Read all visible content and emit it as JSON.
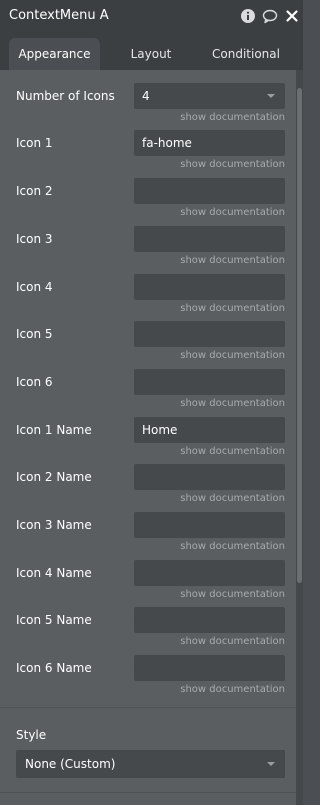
{
  "header": {
    "title": "ContextMenu A",
    "icons": [
      "info-icon",
      "comment-icon",
      "close-icon"
    ]
  },
  "tabs": [
    {
      "label": "Appearance",
      "active": true
    },
    {
      "label": "Layout",
      "active": false
    },
    {
      "label": "Conditional",
      "active": false
    }
  ],
  "doc_link": "show documentation",
  "fields": [
    {
      "label": "Number of Icons",
      "value": "4",
      "type": "select"
    },
    {
      "label": "Icon 1",
      "value": "fa-home",
      "type": "text"
    },
    {
      "label": "Icon 2",
      "value": "",
      "type": "text"
    },
    {
      "label": "Icon 3",
      "value": "",
      "type": "text"
    },
    {
      "label": "Icon 4",
      "value": "",
      "type": "text"
    },
    {
      "label": "Icon 5",
      "value": "",
      "type": "text"
    },
    {
      "label": "Icon 6",
      "value": "",
      "type": "text"
    },
    {
      "label": "Icon 1 Name",
      "value": "Home",
      "type": "text"
    },
    {
      "label": "Icon 2 Name",
      "value": "",
      "type": "text"
    },
    {
      "label": "Icon 3 Name",
      "value": "",
      "type": "text"
    },
    {
      "label": "Icon 4 Name",
      "value": "",
      "type": "text"
    },
    {
      "label": "Icon 5 Name",
      "value": "",
      "type": "text"
    },
    {
      "label": "Icon 6 Name",
      "value": "",
      "type": "text"
    }
  ],
  "style": {
    "label": "Style",
    "value": "None (Custom)"
  },
  "colors": {
    "panel_bg": "#5a5e61",
    "header_bg": "#3b3f42",
    "input_bg": "#45494c",
    "doc_text": "#a7abae"
  }
}
